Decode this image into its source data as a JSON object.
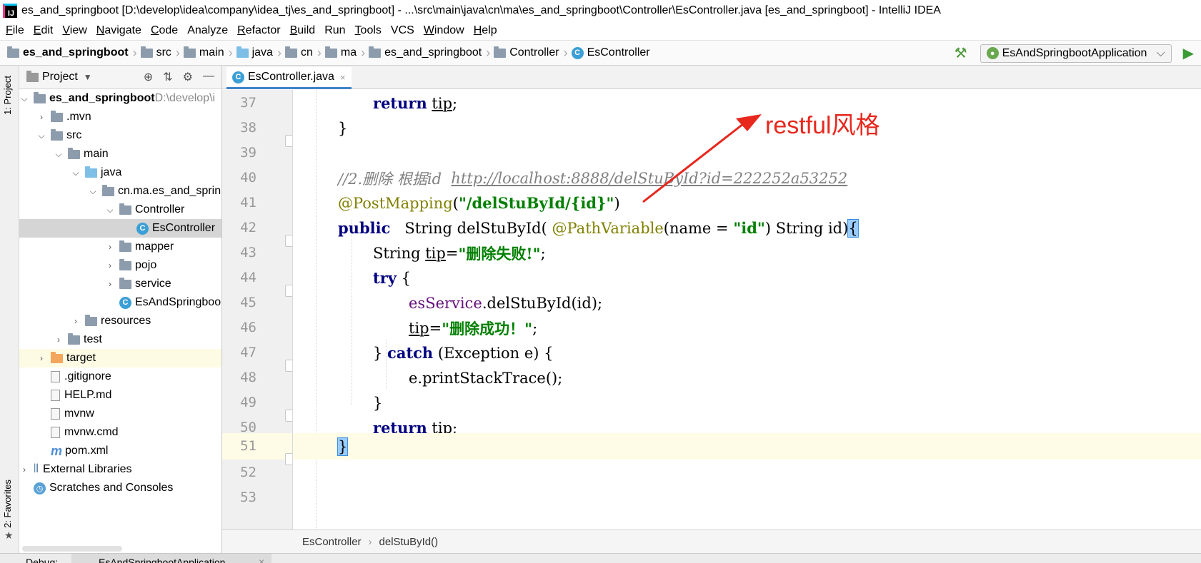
{
  "window": {
    "app_logo": "IJ",
    "title": "es_and_springboot [D:\\develop\\idea\\company\\idea_tj\\es_and_springboot] - ...\\src\\main\\java\\cn\\ma\\es_and_springboot\\Controller\\EsController.java [es_and_springboot] - IntelliJ IDEA"
  },
  "menu": [
    {
      "mn": "F",
      "rest": "ile"
    },
    {
      "mn": "E",
      "rest": "dit"
    },
    {
      "mn": "V",
      "rest": "iew"
    },
    {
      "mn": "N",
      "rest": "avigate"
    },
    {
      "mn": "C",
      "rest": "ode"
    },
    {
      "mn": "",
      "rest": "Analyze"
    },
    {
      "mn": "R",
      "rest": "efactor"
    },
    {
      "mn": "B",
      "rest": "uild"
    },
    {
      "mn": "",
      "rest": "Run"
    },
    {
      "mn": "T",
      "rest": "ools"
    },
    {
      "mn": "",
      "rest": "VCS"
    },
    {
      "mn": "W",
      "rest": "indow"
    },
    {
      "mn": "H",
      "rest": "elp"
    }
  ],
  "nav": {
    "crumbs": [
      "es_and_springboot",
      "src",
      "main",
      "java",
      "cn",
      "ma",
      "es_and_springboot",
      "Controller",
      "EsController"
    ],
    "run_config": "EsAndSpringbootApplication",
    "hammer_icon": "hammer-icon",
    "run_icon": "play-icon"
  },
  "sidebar": {
    "tab_project": "1: Project",
    "tab_favorites": "2: Favorites"
  },
  "project": {
    "title": "Project",
    "tree": [
      {
        "label": "es_and_springboot",
        "extra": " D:\\develop\\i",
        "arrow": "⌄",
        "icon": "folder",
        "bold": true
      },
      {
        "label": ".mvn",
        "arrow": "›",
        "icon": "folder"
      },
      {
        "label": "src",
        "arrow": "⌄",
        "icon": "folder"
      },
      {
        "label": "main",
        "arrow": "⌄",
        "icon": "folder"
      },
      {
        "label": "java",
        "arrow": "⌄",
        "icon": "folder-blue"
      },
      {
        "label": "cn.ma.es_and_sprin",
        "arrow": "⌄",
        "icon": "folder"
      },
      {
        "label": "Controller",
        "arrow": "⌄",
        "icon": "folder"
      },
      {
        "label": "EsController",
        "arrow": "",
        "icon": "class",
        "selected": true
      },
      {
        "label": "mapper",
        "arrow": "›",
        "icon": "folder"
      },
      {
        "label": "pojo",
        "arrow": "›",
        "icon": "folder"
      },
      {
        "label": "service",
        "arrow": "›",
        "icon": "folder"
      },
      {
        "label": "EsAndSpringboo",
        "arrow": "",
        "icon": "class"
      },
      {
        "label": "resources",
        "arrow": "›",
        "icon": "folder"
      },
      {
        "label": "test",
        "arrow": "›",
        "icon": "folder"
      },
      {
        "label": "target",
        "arrow": "›",
        "icon": "folder-orange",
        "highlight": true
      },
      {
        "label": ".gitignore",
        "arrow": "",
        "icon": "file"
      },
      {
        "label": "HELP.md",
        "arrow": "",
        "icon": "file"
      },
      {
        "label": "mvnw",
        "arrow": "",
        "icon": "file"
      },
      {
        "label": "mvnw.cmd",
        "arrow": "",
        "icon": "file"
      },
      {
        "label": "pom.xml",
        "arrow": "",
        "icon": "maven"
      },
      {
        "label": "External Libraries",
        "arrow": "›",
        "icon": "libs"
      },
      {
        "label": "Scratches and Consoles",
        "arrow": "",
        "icon": "scratch"
      }
    ]
  },
  "editor": {
    "tab_label": "EsController.java",
    "tab_close": "×",
    "code_crumbs": [
      "EsController",
      "delStuById()"
    ],
    "line_numbers": [
      "37",
      "38",
      "39",
      "40",
      "41",
      "42",
      "43",
      "44",
      "45",
      "46",
      "47",
      "48",
      "49",
      "50",
      "51",
      "52",
      "53"
    ],
    "lines": {
      "l37": {
        "kw": "return",
        "id": "tip",
        "end": ";"
      },
      "l38": "}",
      "l40": {
        "comment": "//2.删除 根据id  ",
        "url": "http://localhost:8888/delStuById?id=222252a53252"
      },
      "l41": {
        "ann": "@PostMapping",
        "open": "(",
        "str": "\"/delStuById/{id}\"",
        "close": ")"
      },
      "l42": {
        "kw": "public",
        "a": "   String delStuById( ",
        "ann": "@PathVariable",
        "b": "(name = ",
        "str": "\"id\"",
        "c": ") String id)",
        "brace": "{"
      },
      "l43": {
        "a": "String ",
        "id": "tip",
        "b": "=",
        "str": "\"删除失败!\"",
        "c": ";"
      },
      "l44": {
        "kw": "try",
        "a": " {"
      },
      "l45": {
        "fld": "esService",
        "a": ".delStuById(id);"
      },
      "l46": {
        "id": "tip",
        "b": "=",
        "str": "\"删除成功！\"",
        "c": ";"
      },
      "l47": {
        "a": "} ",
        "kw": "catch",
        "b": " (Exception e) {"
      },
      "l48": "e.printStackTrace();",
      "l49": "}",
      "l50": {
        "kw": "return",
        "id": "tip",
        "end": ";"
      },
      "l51": "}"
    }
  },
  "annotation": {
    "text": "restful风格",
    "color": "#e8271d"
  },
  "bottom": {
    "debug": "Debug:",
    "app": "EsAndSpringbootApplication",
    "close": "×"
  }
}
